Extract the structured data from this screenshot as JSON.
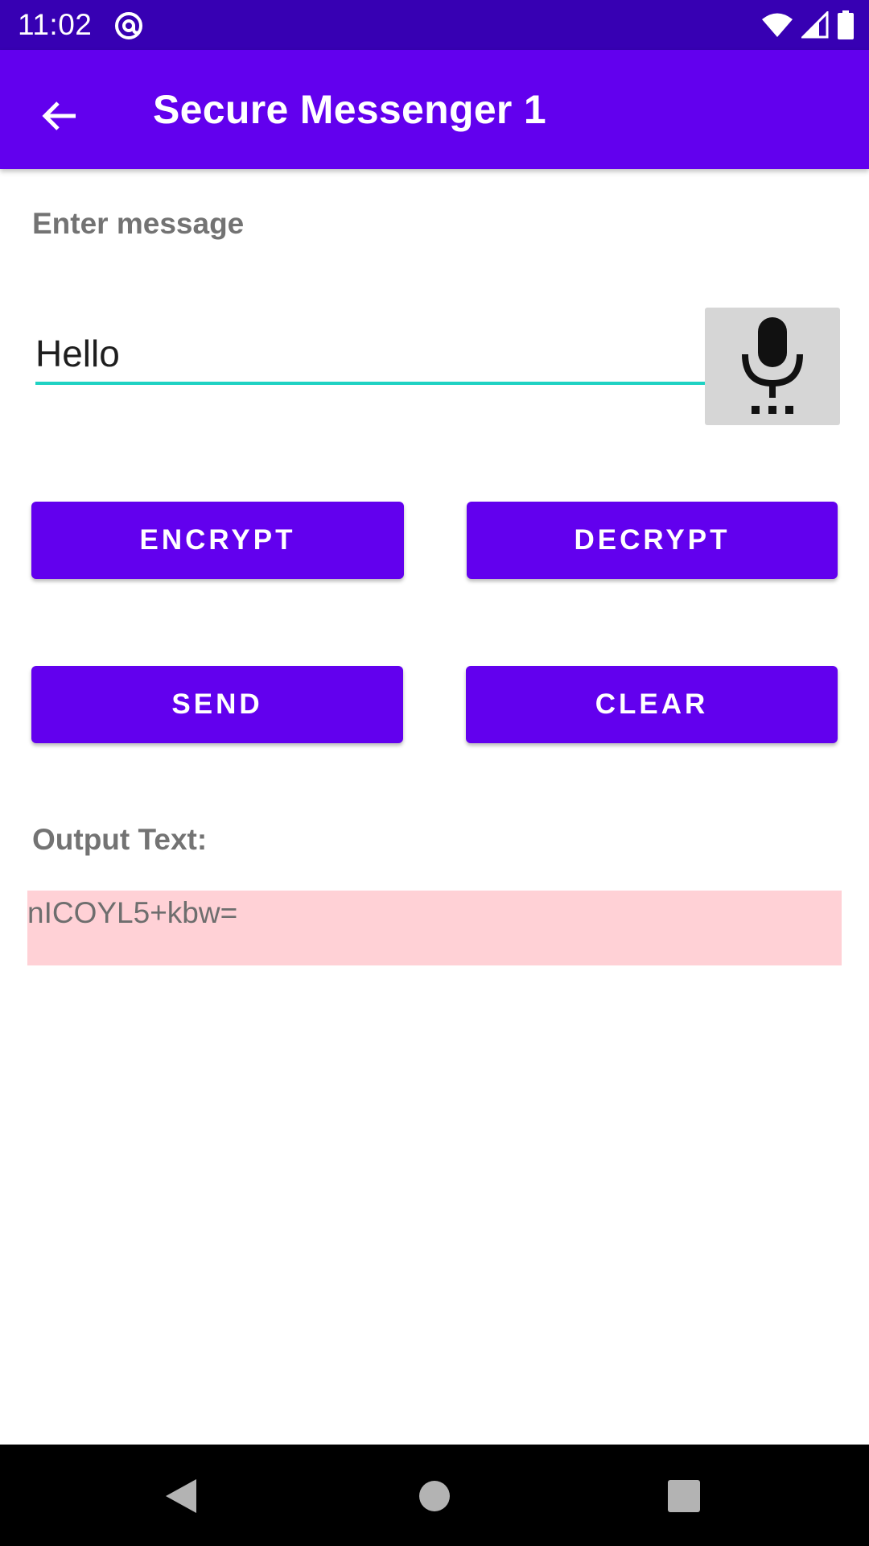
{
  "status_bar": {
    "time": "11:02",
    "icons": [
      "at-sign-icon",
      "wifi-icon",
      "cellular-signal-icon",
      "battery-icon"
    ],
    "background_color": "#3700b3"
  },
  "app_bar": {
    "title": "Secure Messenger 1",
    "back_icon": "arrow-back-icon",
    "background_color": "#6200ee"
  },
  "form": {
    "message_label": "Enter message",
    "message_value": "Hello",
    "mic_icon": "microphone-icon",
    "accent_color": "#1fd2c3"
  },
  "buttons": {
    "encrypt": "ENCRYPT",
    "decrypt": "DECRYPT",
    "send": "SEND",
    "clear": "CLEAR",
    "color": "#6200ee"
  },
  "output": {
    "label": "Output Text:",
    "value": "nICOYL5+kbw=",
    "background_color": "#ffd1d6"
  },
  "nav_bar": {
    "icons": [
      "nav-back-icon",
      "nav-home-icon",
      "nav-recents-icon"
    ]
  }
}
